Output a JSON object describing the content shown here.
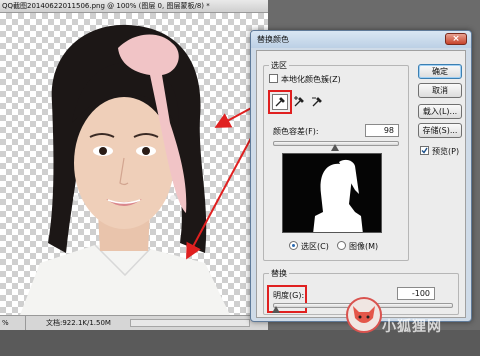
{
  "document": {
    "title": "QQ截图20140622011506.png @ 100% (图层 0, 图层蒙板/8) *",
    "zoom": "%",
    "doc_size": "文档:922.1K/1.50M"
  },
  "dialog": {
    "title": "替换颜色",
    "selection_group": "选区",
    "localized_clusters": "本地化颜色簇(Z)",
    "fuzziness_label": "颜色容差(F):",
    "fuzziness_value": "98",
    "fuzziness_level": 0.49,
    "radio_selection": "选区(C)",
    "radio_image": "图像(M)",
    "replace_group": "替换",
    "lightness_label": "明度(G):",
    "lightness_value": "-100",
    "lightness_level": 0.0,
    "buttons": {
      "ok": "确定",
      "cancel": "取消",
      "load": "载入(L)...",
      "save": "存储(S)...",
      "preview": "预览(P)"
    },
    "close": "×"
  },
  "watermark": {
    "text": "小狐狸网"
  },
  "colors": {
    "annotation": "#e02020",
    "dialog_frame": "#cfdbe8"
  }
}
